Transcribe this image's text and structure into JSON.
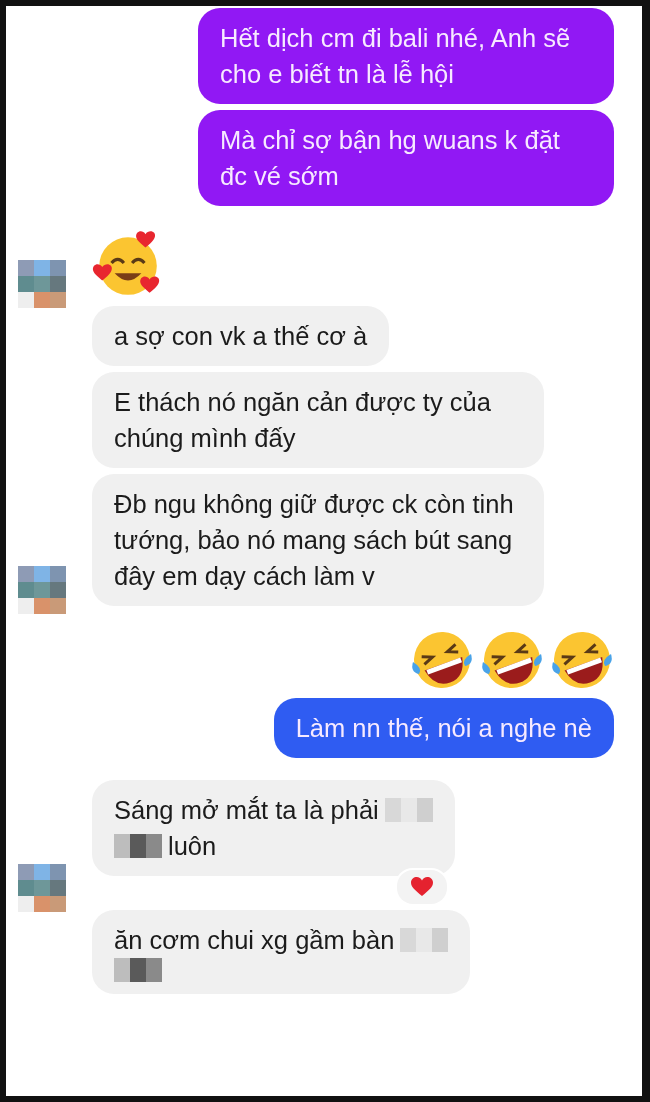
{
  "messages": [
    {
      "kind": "text",
      "outgoing": true,
      "color": "#9118f4",
      "text": "Hết dịch cm đi bali nhé, Anh sẽ cho e biết tn là lễ hội"
    },
    {
      "kind": "text",
      "outgoing": true,
      "color": "#9118f4",
      "text": "Mà chỉ sợ bận hg wuans k đặt đc vé sớm"
    },
    {
      "kind": "emoji",
      "outgoing": false,
      "avatar": true,
      "emojis": [
        {
          "kind": "smiling-hearts"
        }
      ]
    },
    {
      "kind": "text",
      "outgoing": false,
      "text": "a sợ con vk a thế cơ à"
    },
    {
      "kind": "text",
      "outgoing": false,
      "text": "E thách nó ngăn cản được ty của chúng mình đấy"
    },
    {
      "kind": "text",
      "outgoing": false,
      "avatar": true,
      "text": "Đb ngu không giữ được ck còn tinh tướng, bảo nó mang sách bút sang đây em dạy cách làm v"
    },
    {
      "kind": "emoji",
      "outgoing": true,
      "emojis": [
        {
          "kind": "laughing"
        },
        {
          "kind": "laughing"
        },
        {
          "kind": "laughing"
        }
      ]
    },
    {
      "kind": "text",
      "outgoing": true,
      "color": "#2f5cf2",
      "text": "Làm nn thế, nói a nghe nè"
    },
    {
      "kind": "mixed",
      "outgoing": false,
      "avatar": true,
      "reaction": {
        "kind": "heart"
      },
      "lines": [
        [
          {
            "kind": "text",
            "text": "Sáng mở mắt ta là phải"
          },
          {
            "kind": "redacted"
          }
        ],
        [
          {
            "kind": "redacted"
          },
          {
            "kind": "text",
            "text": "luôn"
          }
        ]
      ]
    },
    {
      "kind": "mixed",
      "outgoing": false,
      "lines": [
        [
          {
            "kind": "text",
            "text": "ăn cơm chui xg gầm bàn"
          },
          {
            "kind": "redacted"
          }
        ],
        [
          {
            "kind": "redacted"
          }
        ]
      ]
    }
  ]
}
